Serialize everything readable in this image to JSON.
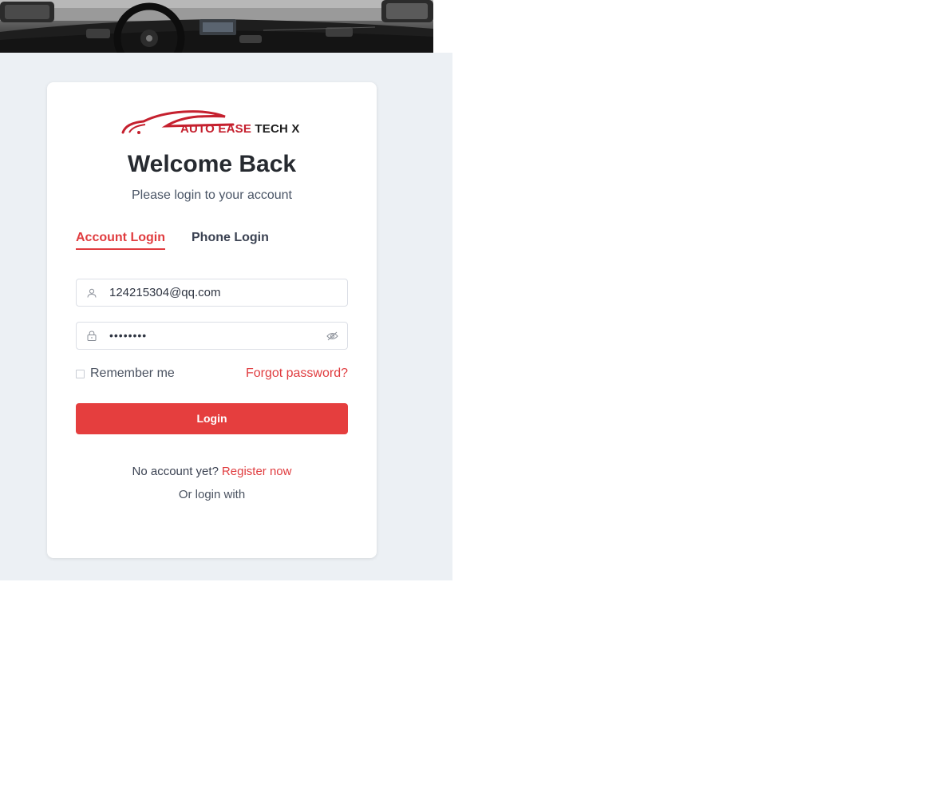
{
  "brand": {
    "name_part1": "AUTO EASE",
    "name_part2": "TECH X",
    "accent_color": "#c5202e"
  },
  "hero": {
    "image": "car-interior-dashboard"
  },
  "login_card": {
    "title": "Welcome Back",
    "subtitle": "Please login to your account",
    "tabs": [
      {
        "label": "Account Login",
        "active": true
      },
      {
        "label": "Phone Login",
        "active": false
      }
    ],
    "email": {
      "icon": "user-icon",
      "value": "124215304@qq.com"
    },
    "password": {
      "icon": "lock-icon",
      "masked_value": "••••••••",
      "toggle_icon": "eye-off-icon"
    },
    "remember_label": "Remember me",
    "remember_checked": false,
    "forgot_label": "Forgot password?",
    "login_label": "Login",
    "register_prompt": "No account yet?",
    "register_link": "Register now",
    "alt_login_label": "Or login with"
  },
  "colors": {
    "primary": "#e53e3e",
    "panel_background": "#ecf0f4"
  }
}
